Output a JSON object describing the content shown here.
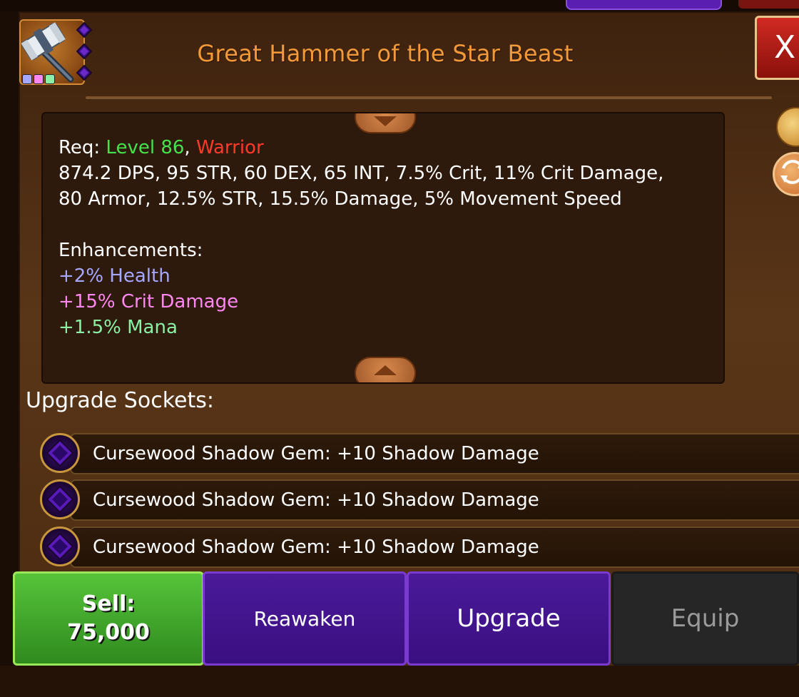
{
  "item": {
    "name": "Great Hammer of the Star Beast",
    "icon": "great-hammer-icon",
    "enhancement_dot_colors": [
      "#a6a8ff",
      "#ff88f0",
      "#8cf0a4"
    ],
    "socket_gem_count": 3
  },
  "close_button": {
    "label": "X"
  },
  "requirements": {
    "prefix": "Req: ",
    "level": "Level 86",
    "separator": ", ",
    "class": "Warrior"
  },
  "stats": {
    "line1": "874.2 DPS, 95 STR, 60 DEX, 65 INT, 7.5% Crit, 11% Crit Damage,",
    "line2": "80 Armor, 12.5% STR, 15.5% Damage, 5% Movement Speed"
  },
  "enhancements": {
    "label": "Enhancements:",
    "items": [
      "+2% Health",
      "+15% Crit Damage",
      "+1.5% Mana"
    ]
  },
  "upgrade_sockets": {
    "label": "Upgrade Sockets:",
    "items": [
      "Cursewood Shadow Gem: +10 Shadow Damage",
      "Cursewood Shadow Gem: +10 Shadow Damage",
      "Cursewood Shadow Gem: +10 Shadow Damage"
    ]
  },
  "actions": {
    "sell_label": "Sell:",
    "sell_price": "75,000",
    "reawaken": "Reawaken",
    "upgrade": "Upgrade",
    "equip": "Equip"
  },
  "colors": {
    "title": "#f29a3a",
    "level": "#44e34a",
    "class": "#ff3a2a",
    "sell_button": "#3fa02a",
    "purple_button": "#3f1288"
  },
  "side_icons": [
    "gold-bag-icon",
    "swap-icon"
  ]
}
